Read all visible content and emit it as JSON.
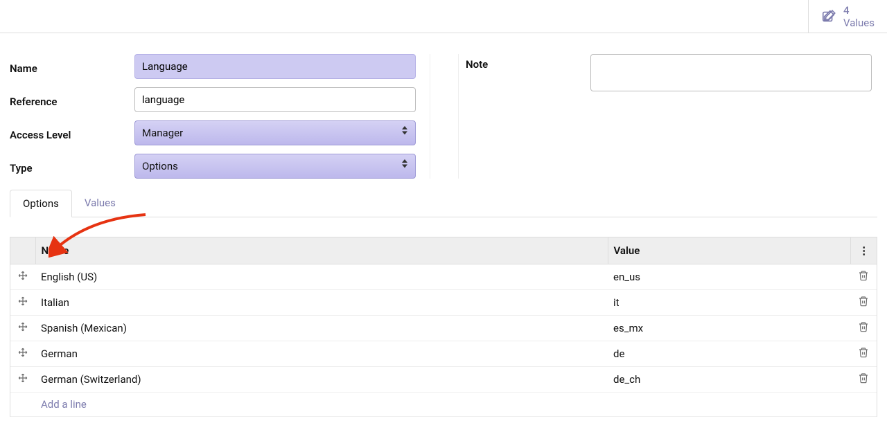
{
  "topbar": {
    "stat_count": "4",
    "stat_label": "Values"
  },
  "form": {
    "name_label": "Name",
    "name_value": "Language",
    "reference_label": "Reference",
    "reference_value": "language",
    "access_level_label": "Access Level",
    "access_level_value": "Manager",
    "type_label": "Type",
    "type_value": "Options",
    "note_label": "Note",
    "note_value": ""
  },
  "tabs": [
    {
      "label": "Options",
      "active": true
    },
    {
      "label": "Values",
      "active": false
    }
  ],
  "table": {
    "headers": {
      "name": "Name",
      "value": "Value"
    },
    "rows": [
      {
        "name": "English (US)",
        "value": "en_us"
      },
      {
        "name": "Italian",
        "value": "it"
      },
      {
        "name": "Spanish (Mexican)",
        "value": "es_mx"
      },
      {
        "name": "German",
        "value": "de"
      },
      {
        "name": "German (Switzerland)",
        "value": "de_ch"
      }
    ],
    "add_line_label": "Add a line"
  }
}
